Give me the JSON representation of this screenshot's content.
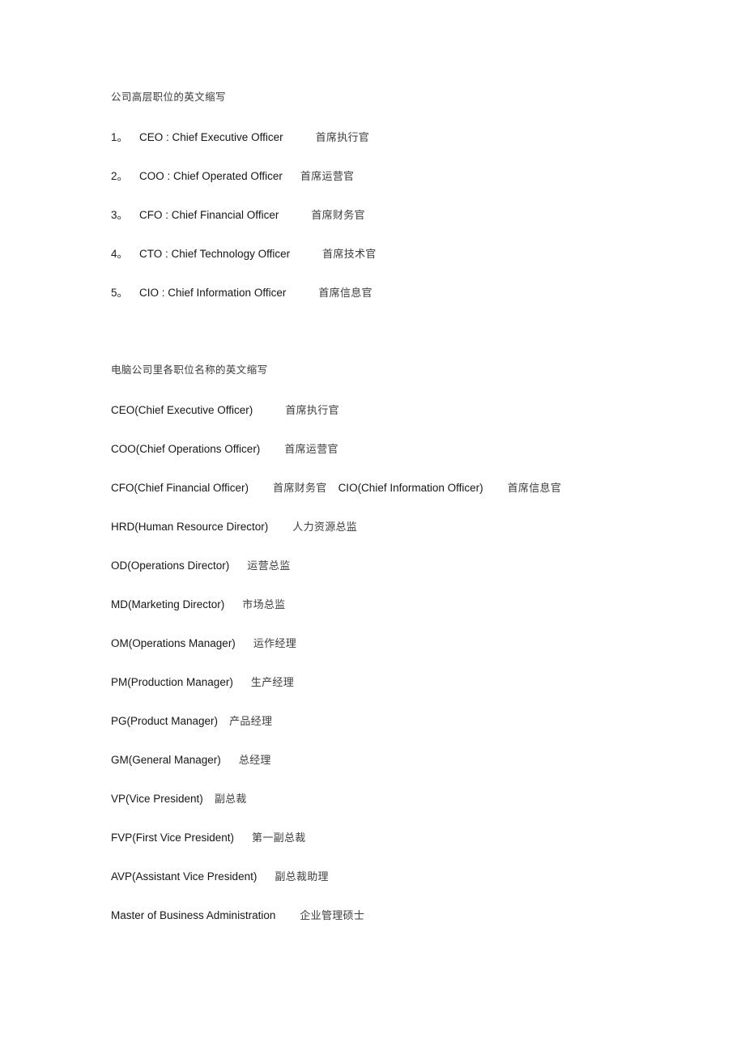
{
  "document": {
    "section1": {
      "heading": "公司高层职位的英文缩写",
      "items": [
        {
          "num": "1。",
          "en": "CEO : Chief Executive Officer",
          "zh": "首席执行官",
          "gap": "xxl"
        },
        {
          "num": "2。",
          "en": "COO  :   Chief Operated Officer",
          "zh": "首席运营官",
          "gap": "lg"
        },
        {
          "num": "3。",
          "en": "CFO  : Chief Financial Officer",
          "zh": "首席财务官",
          "gap": "xxl"
        },
        {
          "num": "4。",
          "en": "CTO  : Chief Technology Officer",
          "zh": "首席技术官",
          "gap": "xxl"
        },
        {
          "num": "5。",
          "en": "CIO  :  Chief Information Officer",
          "zh": "首席信息官",
          "gap": "xxl"
        }
      ]
    },
    "section2": {
      "heading": "电脑公司里各职位名称的英文缩写",
      "items": [
        {
          "en": "CEO(Chief Executive Officer)",
          "zh": "首席执行官",
          "gap": "xxl"
        },
        {
          "en": "COO(Chief Operations Officer)",
          "zh": "首席运营官",
          "gap": "xl"
        },
        {
          "en": "CFO(Chief Financial Officer)",
          "zh": "首席财务官",
          "gap": "xl",
          "en2": "CIO(Chief Information Officer)",
          "zh2": "首席信息官",
          "gap2": "xl"
        },
        {
          "en": "HRD(Human Resource Director)",
          "zh": "人力资源总监",
          "gap": "xl"
        },
        {
          "en": "OD(Operations Director)",
          "zh": "运营总监",
          "gap": "lg"
        },
        {
          "en": "MD(Marketing Director)",
          "zh": "市场总监",
          "gap": "lg"
        },
        {
          "en": "OM(Operations Manager)",
          "zh": "运作经理",
          "gap": "lg"
        },
        {
          "en": "PM(Production Manager)",
          "zh": "生产经理",
          "gap": "lg"
        },
        {
          "en": "PG(Product Manager)",
          "zh": "产品经理",
          "gap": "md"
        },
        {
          "en": "GM(General Manager)",
          "zh": "总经理",
          "gap": "lg"
        },
        {
          "en": "VP(Vice President)",
          "zh": "副总裁",
          "gap": "md"
        },
        {
          "en": "FVP(First Vice President)",
          "zh": "第一副总裁",
          "gap": "lg"
        },
        {
          "en": "AVP(Assistant Vice President)",
          "zh": "副总裁助理",
          "gap": "lg"
        },
        {
          "en": "Master of Business Administration",
          "zh": "企业管理硕士",
          "gap": "xl"
        }
      ]
    }
  }
}
